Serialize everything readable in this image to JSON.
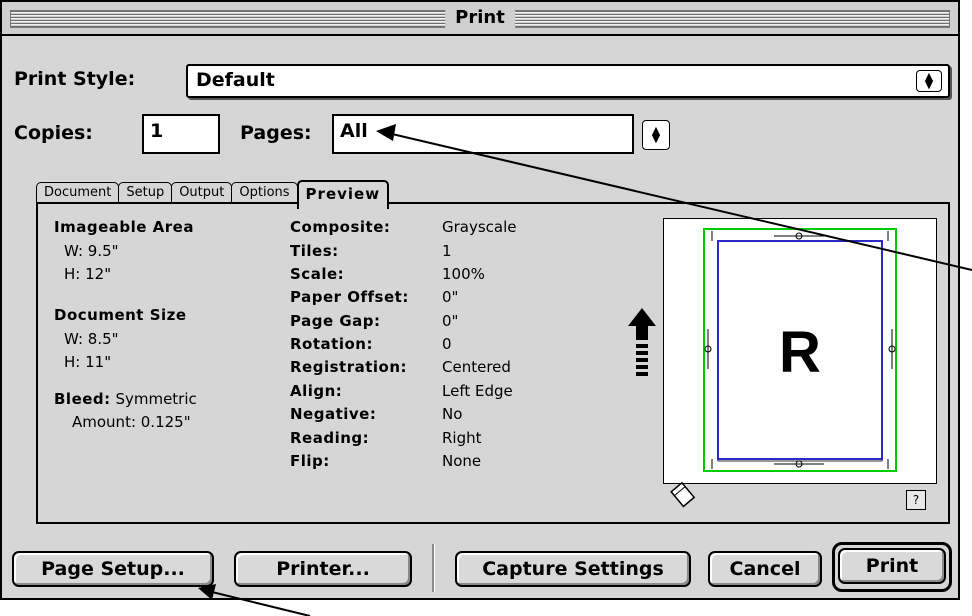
{
  "window": {
    "title": "Print"
  },
  "print_style": {
    "label": "Print Style:",
    "value": "Default"
  },
  "copies": {
    "label": "Copies:",
    "value": "1"
  },
  "pages": {
    "label": "Pages:",
    "value": "All"
  },
  "tabs": [
    {
      "label": "Document"
    },
    {
      "label": "Setup"
    },
    {
      "label": "Output"
    },
    {
      "label": "Options"
    },
    {
      "label": "Preview",
      "active": true
    }
  ],
  "preview": {
    "imageable_area": {
      "label": "Imageable Area",
      "w": "W: 9.5\"",
      "h": "H: 12\""
    },
    "document_size": {
      "label": "Document Size",
      "w": "W: 8.5\"",
      "h": "H: 11\""
    },
    "bleed": {
      "label": "Bleed:",
      "value": "Symmetric",
      "amount": "Amount: 0.125\""
    },
    "settings": [
      {
        "label": "Composite:",
        "value": "Grayscale"
      },
      {
        "label": "Tiles:",
        "value": "1"
      },
      {
        "label": "Scale:",
        "value": "100%"
      },
      {
        "label": "Paper Offset:",
        "value": "0\""
      },
      {
        "label": "Page Gap:",
        "value": "0\""
      },
      {
        "label": "Rotation:",
        "value": "0"
      },
      {
        "label": "Registration:",
        "value": "Centered"
      },
      {
        "label": "Align:",
        "value": "Left Edge"
      },
      {
        "label": "Negative:",
        "value": "No"
      },
      {
        "label": "Reading:",
        "value": "Right"
      },
      {
        "label": "Flip:",
        "value": "None"
      }
    ],
    "page_letter": "R",
    "help_glyph": "?"
  },
  "buttons": {
    "page_setup": "Page Setup...",
    "printer": "Printer...",
    "capture_settings": "Capture Settings",
    "cancel": "Cancel",
    "print": "Print"
  },
  "icons": {
    "feed_direction": "up-arrow-icon",
    "paper_orientation": "page-tilt-icon",
    "help": "help-icon",
    "popup_arrows": "up-down-arrows-icon"
  },
  "colors": {
    "window_bg": "#d6d6d6",
    "imageable_border": "#00cc00",
    "document_border": "#2a2ac8"
  }
}
